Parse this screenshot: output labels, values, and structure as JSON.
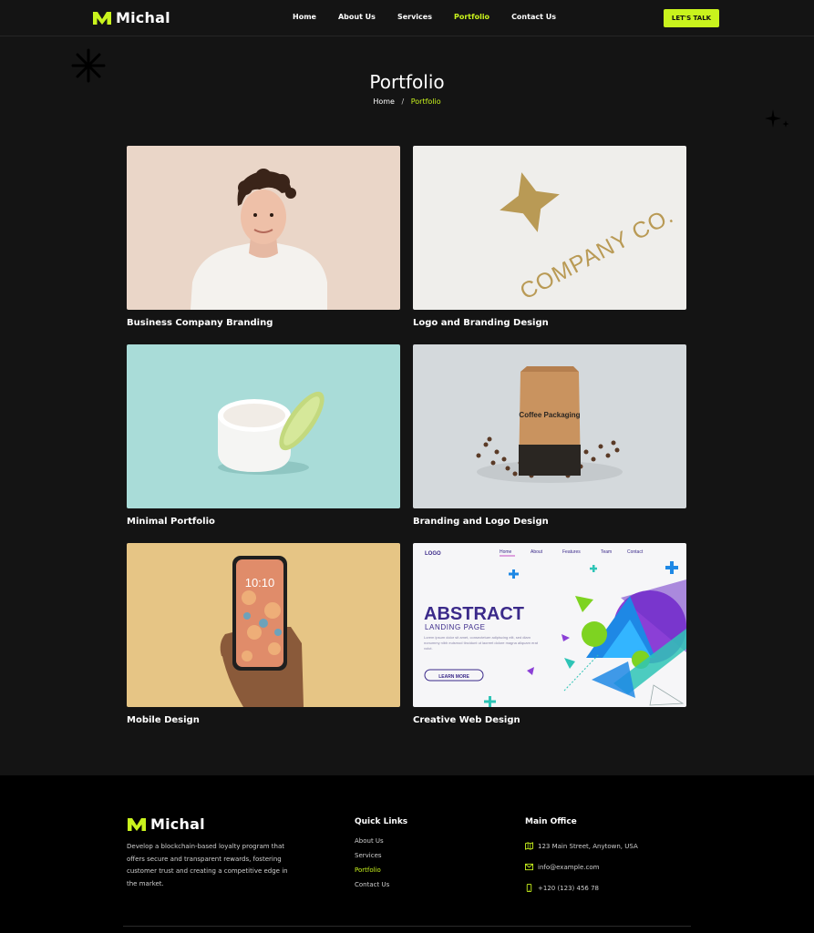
{
  "brand": {
    "name": "Michal",
    "accent": "#c9f31d"
  },
  "nav": {
    "items": [
      {
        "label": "Home",
        "active": false
      },
      {
        "label": "About Us",
        "active": false
      },
      {
        "label": "Services",
        "active": false
      },
      {
        "label": "Portfolio",
        "active": true
      },
      {
        "label": "Contact Us",
        "active": false
      }
    ],
    "cta_label": "LET'S TALK"
  },
  "hero": {
    "title": "Portfolio",
    "breadcrumb": {
      "home": "Home",
      "separator": "/",
      "current": "Portfolio"
    }
  },
  "portfolio": {
    "items": [
      {
        "title": "Business Company Branding",
        "image": "portrait-young-man-hoodie"
      },
      {
        "title": "Logo and Branding Design",
        "image": "gold-logo-mockup",
        "image_text": "COMPANY CO."
      },
      {
        "title": "Minimal Portfolio",
        "image": "cream-jar-mint-background"
      },
      {
        "title": "Branding and Logo Design",
        "image": "coffee-bag-mockup",
        "image_text": "Coffee Packaging"
      },
      {
        "title": "Mobile Design",
        "image": "hand-holding-phone",
        "image_text": "10:10"
      },
      {
        "title": "Creative Web Design",
        "image": "abstract-landing-page",
        "mock": {
          "logo": "LOGO",
          "nav": [
            "Home",
            "About",
            "Features",
            "Team",
            "Contact"
          ],
          "headline": "ABSTRACT",
          "subheadline": "LANDING PAGE",
          "body": "Lorem ipsum dolor sit amet, consectetuer adipiscing elit, sed diam nonummy nibh euismod tincidunt ut laoreet dolore magna aliquam erat volut.",
          "button": "LEARN MORE"
        }
      }
    ]
  },
  "footer": {
    "brand": "Michal",
    "description": "Develop a blockchain-based loyalty program that offers secure and transparent rewards, fostering customer trust and creating a competitive edge in the market.",
    "quick_links": {
      "heading": "Quick Links",
      "items": [
        {
          "label": "About Us",
          "active": false
        },
        {
          "label": "Services",
          "active": false
        },
        {
          "label": "Portfolio",
          "active": true
        },
        {
          "label": "Contact Us",
          "active": false
        }
      ]
    },
    "office": {
      "heading": "Main Office",
      "address": "123 Main Street, Anytown, USA",
      "email": "info@example.com",
      "phone": "+120 (123) 456 78",
      "icons": [
        "map-icon",
        "mail-icon",
        "phone-icon"
      ]
    }
  }
}
